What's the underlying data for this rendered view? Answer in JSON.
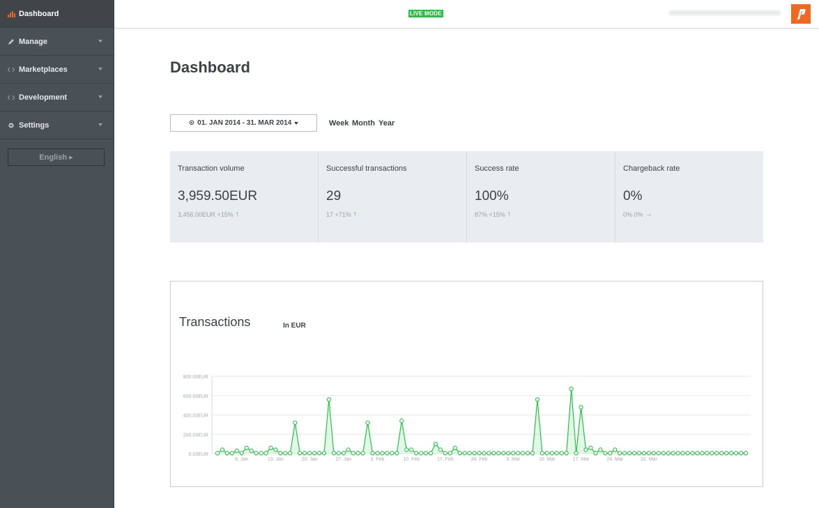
{
  "sidebar": {
    "items": [
      {
        "label": "Dashboard",
        "icon": "bar-chart-icon"
      },
      {
        "label": "Manage",
        "icon": "pencil-icon"
      },
      {
        "label": "Marketplaces",
        "icon": "code-icon"
      },
      {
        "label": "Development",
        "icon": "code-icon"
      },
      {
        "label": "Settings",
        "icon": "gear-icon"
      }
    ],
    "language": "English ▸"
  },
  "topbar": {
    "mode_badge": "LIVE MODE"
  },
  "page": {
    "title": "Dashboard"
  },
  "filters": {
    "date_range": "01. JAN 2014 - 31. MAR 2014",
    "periods": [
      "Week",
      "Month",
      "Year"
    ]
  },
  "stats": [
    {
      "label": "Transaction volume",
      "value": "3,959.50EUR",
      "sub": "3,456.00EUR +15%",
      "trend": "up"
    },
    {
      "label": "Successful transactions",
      "value": "29",
      "sub": "17 +71%",
      "trend": "up"
    },
    {
      "label": "Success rate",
      "value": "100%",
      "sub": "87% +15%",
      "trend": "up"
    },
    {
      "label": "Chargeback rate",
      "value": "0%",
      "sub": "0% 0%",
      "trend": "flat"
    }
  ],
  "colors": {
    "accent": "#25c244",
    "sidebar": "#4a5156",
    "brand": "#f26722",
    "stats_bg": "#e9edef"
  },
  "chart_data": {
    "type": "area",
    "title": "Transactions",
    "subtitle": "In EUR",
    "ylim": [
      0,
      800
    ],
    "y_ticks": [
      "0.00EUR",
      "200.00EUR",
      "400.00EUR",
      "600.00EUR",
      "800.00EUR"
    ],
    "x_ticks": [
      "6. Jan",
      "13. Jan",
      "20. Jan",
      "27. Jan",
      "3. Feb",
      "10. Feb",
      "17. Feb",
      "24. Feb",
      "3. Mar",
      "10. Mar",
      "17. Mar",
      "24. Mar",
      "31. Mar"
    ],
    "grid": true,
    "series": [
      {
        "values": [
          5,
          40,
          5,
          5,
          30,
          5,
          60,
          30,
          5,
          5,
          5,
          60,
          40,
          5,
          5,
          5,
          320,
          5,
          5,
          5,
          5,
          5,
          5,
          560,
          5,
          5,
          5,
          40,
          5,
          5,
          5,
          320,
          5,
          5,
          5,
          5,
          5,
          5,
          340,
          40,
          40,
          5,
          5,
          5,
          5,
          100,
          40,
          5,
          5,
          60,
          5,
          5,
          5,
          5,
          5,
          5,
          5,
          5,
          5,
          5,
          5,
          5,
          5,
          5,
          5,
          5,
          560,
          5,
          5,
          5,
          5,
          5,
          5,
          670,
          5,
          480,
          40,
          60,
          5,
          40,
          5,
          5,
          40,
          5,
          5,
          5,
          5,
          5,
          5,
          5,
          5,
          5,
          5,
          5,
          5,
          5,
          5,
          5,
          5,
          5,
          5,
          5,
          5,
          5,
          5,
          5,
          5,
          5,
          5,
          5
        ]
      }
    ]
  }
}
